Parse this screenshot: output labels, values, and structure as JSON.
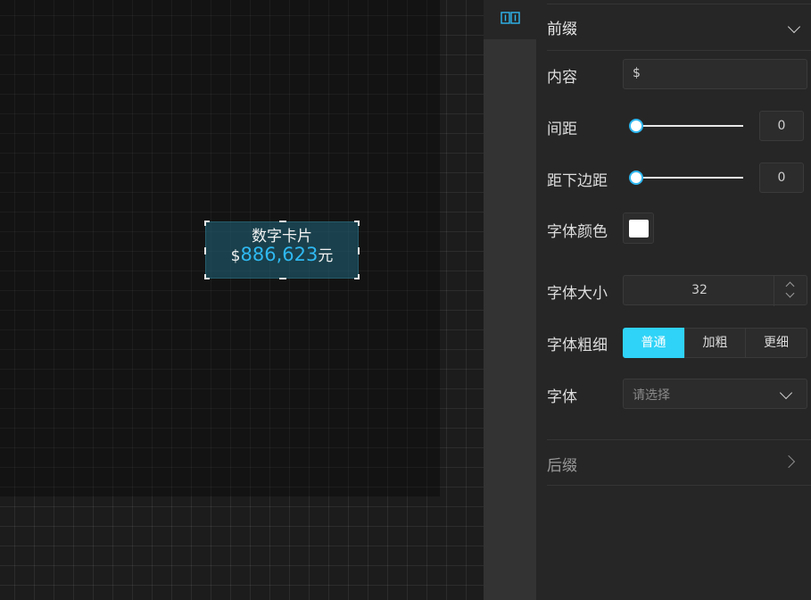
{
  "canvas": {
    "card": {
      "title": "数字卡片",
      "prefix": "$",
      "value": "886,623",
      "suffix": "元"
    }
  },
  "sidebar": {
    "layer_icon_glyph": "⿰"
  },
  "panel": {
    "prefix_section": {
      "title": "前缀",
      "content_label": "内容",
      "content_value": "$",
      "spacing_label": "间距",
      "spacing_value": "0",
      "bottom_margin_label": "距下边距",
      "bottom_margin_value": "0",
      "font_color_label": "字体颜色",
      "font_color": "#ffffff",
      "font_size_label": "字体大小",
      "font_size_value": "32",
      "font_weight_label": "字体粗细",
      "font_weight_options": [
        "普通",
        "加粗",
        "更细"
      ],
      "font_weight_selected": "普通",
      "font_family_label": "字体",
      "font_family_placeholder": "请选择"
    },
    "suffix_section": {
      "title": "后缀"
    }
  },
  "colors": {
    "accent": "#2fd3f7",
    "number": "#2fb8f1"
  }
}
